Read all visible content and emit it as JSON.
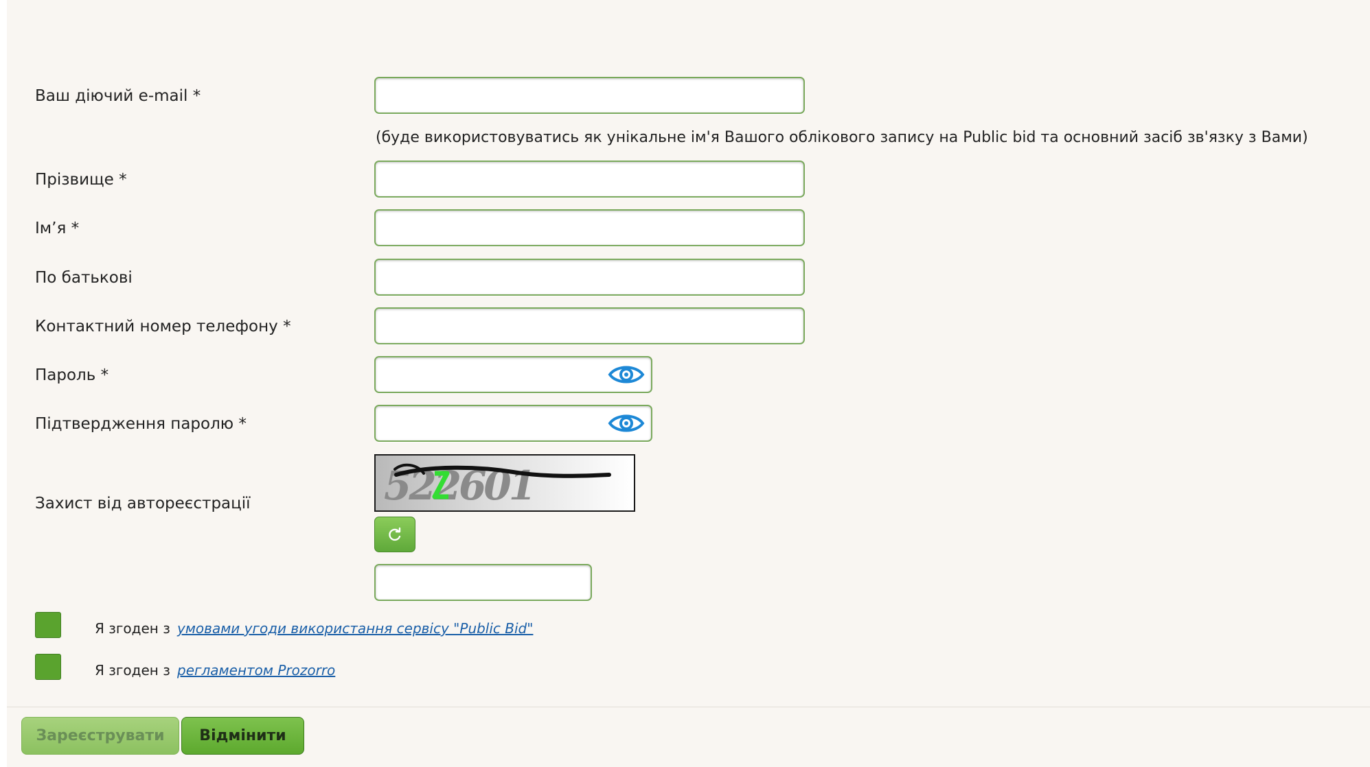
{
  "form": {
    "email": {
      "label": "Ваш діючий e-mail  *",
      "value": "",
      "hint": "(буде використовуватись як унікальне ім'я Вашого облікового запису на Public bid та основний засіб зв'язку з Вами)"
    },
    "surname": {
      "label": "Прізвище *",
      "value": ""
    },
    "name": {
      "label": "Ім’я *",
      "value": ""
    },
    "patronymic": {
      "label": "По батькові",
      "value": ""
    },
    "phone": {
      "label": "Контактний номер телефону *",
      "value": ""
    },
    "password": {
      "label": "Пароль *",
      "value": ""
    },
    "password_confirm": {
      "label": "Підтвердження паролю *",
      "value": ""
    },
    "captcha": {
      "label": "Захист від автореєстрації",
      "code": "522601",
      "value": ""
    }
  },
  "agreements": [
    {
      "prefix": "Я згоден з",
      "link": "умовами угоди використання сервісу \"Public Bid\"",
      "checked": true
    },
    {
      "prefix": "Я згоден з",
      "link": "регламентом Prozorro",
      "checked": true
    }
  ],
  "buttons": {
    "register": "Зареєструвати",
    "cancel": "Відмінити"
  },
  "colors": {
    "accent": "#5aa32e",
    "input_border": "#7aa95c",
    "eye_icon": "#1d88d6",
    "link": "#1a5fa8"
  },
  "icons": {
    "password_toggle": "eye-icon",
    "captcha_refresh": "refresh-icon"
  }
}
